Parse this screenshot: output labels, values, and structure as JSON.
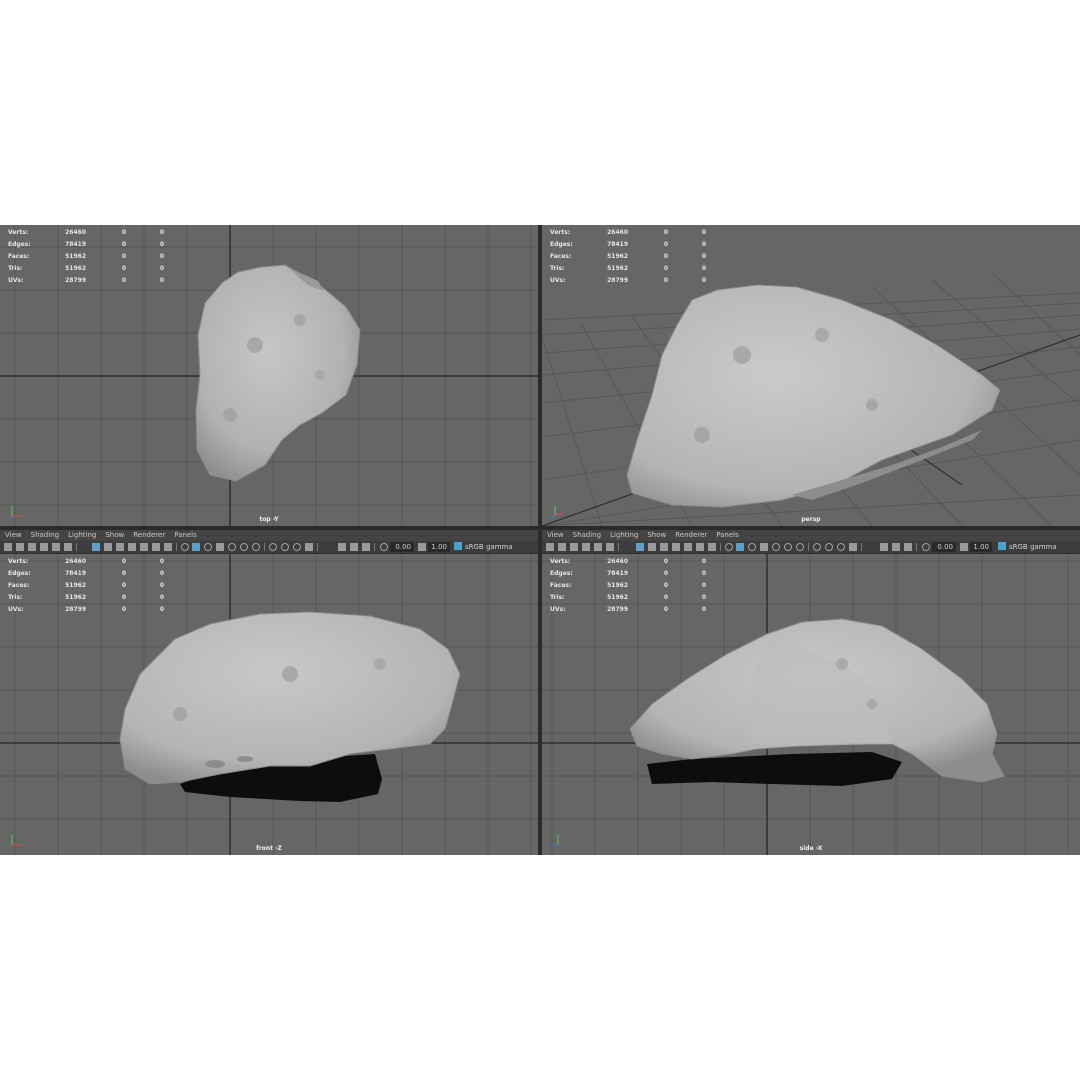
{
  "menu": [
    "View",
    "Shading",
    "Lighting",
    "Show",
    "Renderer",
    "Panels"
  ],
  "toolbar": {
    "exposure": "0.00",
    "gamma": "1.00",
    "color_space": "sRGB gamma"
  },
  "hud": {
    "rows": [
      {
        "label": "Verts:",
        "v1": "26460",
        "v2": "0",
        "v3": "0"
      },
      {
        "label": "Edges:",
        "v1": "78419",
        "v2": "0",
        "v3": "0"
      },
      {
        "label": "Faces:",
        "v1": "51962",
        "v2": "0",
        "v3": "0"
      },
      {
        "label": "Tris:",
        "v1": "51962",
        "v2": "0",
        "v3": "0"
      },
      {
        "label": "UVs:",
        "v1": "28799",
        "v2": "0",
        "v3": "0"
      }
    ]
  },
  "panels": {
    "top": {
      "camera": "top -Y"
    },
    "persp": {
      "camera": "persp"
    },
    "front": {
      "camera": "front -Z"
    },
    "side": {
      "camera": "side -X"
    }
  },
  "colors": {
    "viewport_bg": "#666666",
    "grid": "#555555",
    "grid_axis": "#2f2f2f",
    "mesh": "#b8b8b8",
    "shadow": "#0d0d0d",
    "highlight": "#5f9fc5"
  }
}
